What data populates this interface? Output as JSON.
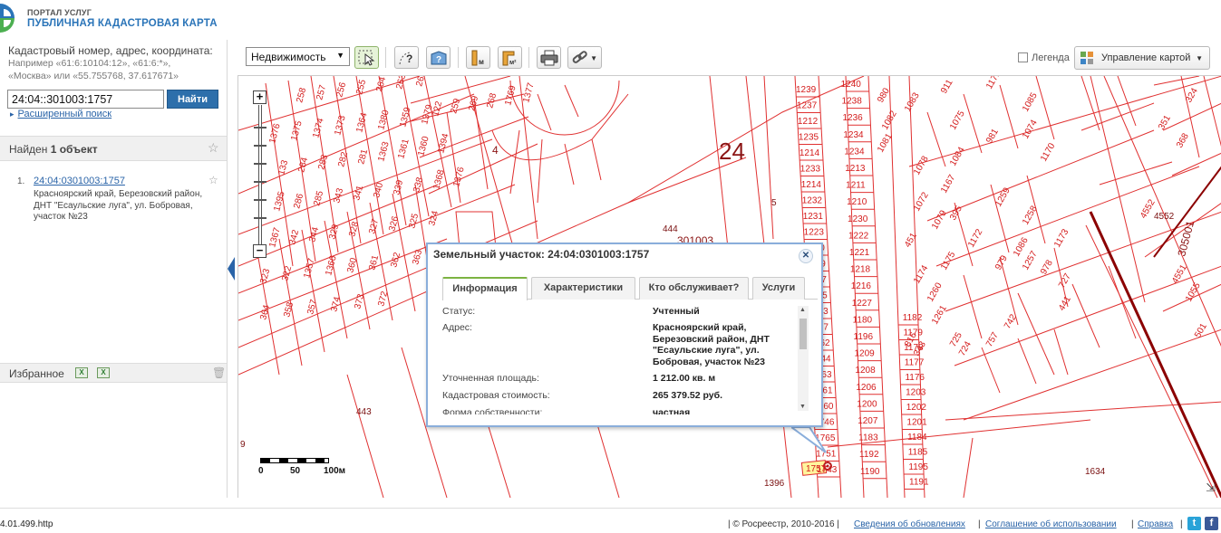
{
  "header": {
    "brand_small": "ПОРТАЛ УСЛУГ",
    "brand_big": "ПУБЛИЧНАЯ КАДАСТРОВАЯ КАРТА"
  },
  "search": {
    "hint_title": "Кадастровый номер, адрес, координата:",
    "hint_example_1": "Например «61:6:10104:12», «61:6:*»,",
    "hint_example_2": "«Москва» или «55.755768, 37.617671»",
    "value": "24:04::301003:1757",
    "button_label": "Найти",
    "advanced_label": "Расширенный поиск"
  },
  "results": {
    "found_prefix": "Найден",
    "found_count": "1 объект",
    "items": [
      {
        "num": "1.",
        "link": "24:04:0301003:1757",
        "address": "Красноярский край, Березовский район, ДНТ \"Есаульские луга\", ул. Бобровая, участок №23"
      }
    ]
  },
  "favorites": {
    "label": "Избранное"
  },
  "toolbar": {
    "layer_select": "Недвижимость",
    "legend_label": "Легенда",
    "map_control_label": "Управление картой"
  },
  "map": {
    "quarter_number": "24",
    "quarter_label": "301003",
    "quarter_right": "305001",
    "scale_labels": [
      "0",
      "50",
      "100м"
    ],
    "parcel_labels_left": [
      "258",
      "257",
      "256",
      "255",
      "264",
      "263",
      "265",
      "122",
      "259",
      "269",
      "268",
      "1769",
      "1377",
      "1376",
      "1375",
      "1374",
      "1373",
      "1364",
      "1380",
      "1359",
      "1379",
      "133",
      "284",
      "283",
      "282",
      "281",
      "1363",
      "1361",
      "1360",
      "1394",
      "1395",
      "286",
      "285",
      "343",
      "341",
      "340",
      "339",
      "338",
      "1368",
      "1376",
      "1367",
      "342",
      "344",
      "329",
      "328",
      "327",
      "326",
      "325",
      "324",
      "323",
      "322",
      "1357",
      "1366",
      "360",
      "361",
      "362",
      "363",
      "364",
      "358",
      "357",
      "374",
      "373",
      "372",
      "376",
      "375",
      "377",
      "378",
      "365",
      "444",
      "443",
      "5",
      "4",
      "9",
      "1396",
      "1634"
    ],
    "parcel_column_a": [
      "1239",
      "1237",
      "1212",
      "1235",
      "1214",
      "1233",
      "1214",
      "1232",
      "1231",
      "1223",
      "1220",
      "1219",
      "1217",
      "1215",
      "1213",
      "1187",
      "1762",
      "1744",
      "1763",
      "1761",
      "1760",
      "1746",
      "1765",
      "1751",
      "1743"
    ],
    "parcel_column_b": [
      "1240",
      "1238",
      "1236",
      "1234",
      "1234",
      "1213",
      "1211",
      "1210",
      "1230",
      "1222",
      "1221",
      "1218",
      "1216",
      "1227",
      "1180",
      "1196",
      "1209",
      "1208",
      "1206",
      "1200",
      "1207",
      "1183",
      "1192",
      "1190"
    ],
    "parcel_column_c": [
      "1182",
      "1179",
      "1178",
      "1177",
      "1176",
      "1203",
      "1202",
      "1201",
      "1184",
      "1185",
      "1195",
      "1191"
    ],
    "parcel_right": [
      "980",
      "1083",
      "911",
      "1171",
      "1085",
      "1075",
      "981",
      "1074",
      "1081",
      "1078",
      "1084",
      "1170",
      "1082",
      "1167",
      "1072",
      "1079",
      "395",
      "1259",
      "1258",
      "1086",
      "451",
      "1172",
      "1257",
      "1173",
      "1174",
      "1175",
      "979",
      "978",
      "727",
      "1260",
      "1261",
      "441",
      "742",
      "757",
      "725",
      "724",
      "343",
      "816",
      "4552",
      "4551",
      "1055",
      "324",
      "352",
      "380",
      "351",
      "368",
      "501",
      "1634"
    ],
    "highlight_label": "1757"
  },
  "popup": {
    "title": "Земельный участок: 24:04:0301003:1757",
    "tabs": [
      "Информация",
      "Характеристики",
      "Кто обслуживает?",
      "Услуги"
    ],
    "rows": [
      {
        "label": "Статус:",
        "value": "Учтенный"
      },
      {
        "label": "Адрес:",
        "value": "Красноярский край, Березовский район, ДНТ \"Есаульские луга\", ул. Бобровая, участок №23"
      },
      {
        "label": "Уточненная площадь:",
        "value": "1 212.00 кв. м"
      },
      {
        "label": "Кадастровая стоимость:",
        "value": "265 379.52 руб."
      },
      {
        "label": "Форма собственности:",
        "value": "частная"
      }
    ]
  },
  "footer": {
    "version": "4.01.499.http",
    "copyright": "| © Росреестр, 2010-2016 |",
    "link_updates": "Сведения об обновлениях",
    "link_terms": "Соглашение об использовании",
    "link_help": "Справка",
    "sep": "|"
  }
}
